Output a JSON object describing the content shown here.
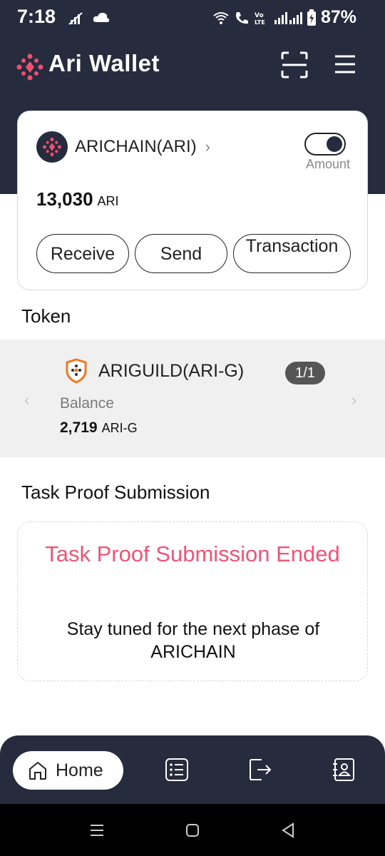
{
  "status_bar": {
    "time": "7:18",
    "battery": "87%"
  },
  "app": {
    "title": "Ari Wallet"
  },
  "wallet": {
    "chain_name": "ARICHAIN(ARI)",
    "toggle_label": "Amount",
    "toggle_on": true,
    "balance_amount": "13,030",
    "balance_unit": "ARI",
    "buttons": {
      "receive": "Receive",
      "send": "Send",
      "transaction": "Transaction"
    }
  },
  "token_section": {
    "title": "Token",
    "token_name": "ARIGUILD(ARI-G)",
    "page_indicator": "1/1",
    "balance_label": "Balance",
    "balance_amount": "2,719",
    "balance_unit": "ARI-G"
  },
  "task_section": {
    "title": "Task Proof Submission",
    "ended_message": "Task Proof Submission Ended",
    "subtitle": "Stay tuned for the next phase of ARICHAIN"
  },
  "bottom_nav": {
    "home_label": "Home"
  },
  "colors": {
    "header_bg": "#262b3d",
    "accent_pink": "#ee5577",
    "brand_logo": "#f0506e",
    "token_shield": "#f07820"
  }
}
